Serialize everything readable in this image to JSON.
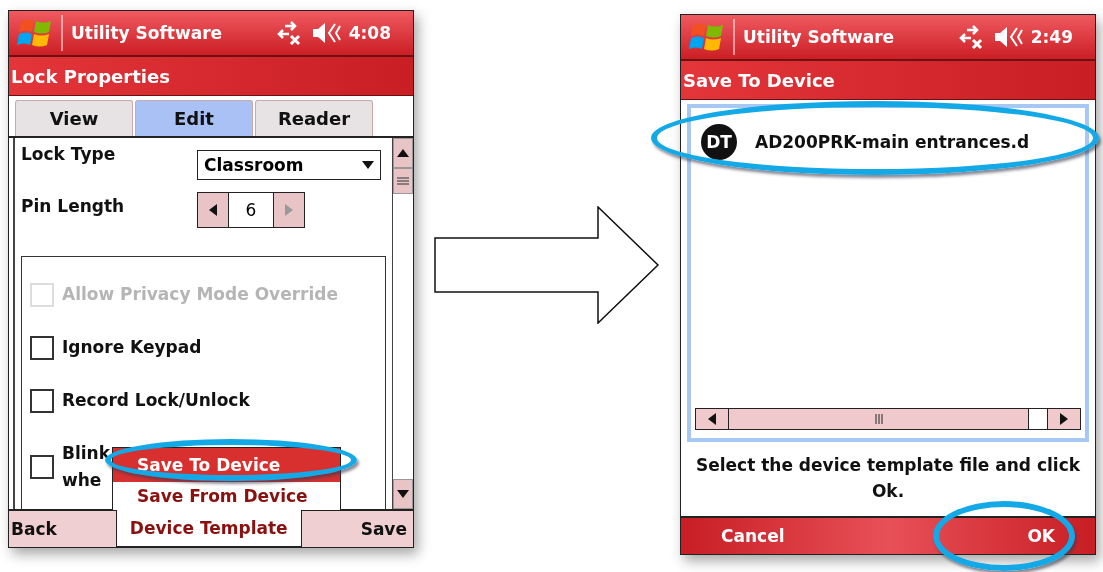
{
  "left_screen": {
    "status_bar": {
      "title": "Utility Software",
      "time": "4:08"
    },
    "title": "Lock Properties",
    "tabs": [
      {
        "label": "View",
        "selected": false
      },
      {
        "label": "Edit",
        "selected": true
      },
      {
        "label": "Reader",
        "selected": false
      }
    ],
    "fields": [
      {
        "kind": "dropdown",
        "label": "Lock Type",
        "value": "Classroom"
      },
      {
        "kind": "spinner",
        "label": "Pin Length",
        "value": "6",
        "at_max": true
      }
    ],
    "options": [
      {
        "label": "Allow Privacy Mode Override",
        "checked": false,
        "disabled": true
      },
      {
        "label": "Ignore Keypad",
        "checked": false,
        "disabled": false
      },
      {
        "label": "Record Lock/Unlock",
        "checked": false,
        "disabled": false
      },
      {
        "label": "Blink\nwhe",
        "checked": false,
        "disabled": false
      }
    ],
    "context_menu": [
      {
        "label": "Save To Device",
        "selected": true
      },
      {
        "label": "Save From Device",
        "selected": false
      }
    ],
    "softkeys": {
      "left": "Back",
      "menu": "Device Template",
      "right": "Save"
    }
  },
  "right_screen": {
    "status_bar": {
      "title": "Utility Software",
      "time": "2:49"
    },
    "title": "Save To Device",
    "files": [
      {
        "icon_text": "DT",
        "name": "AD200PRK-main entrances.d",
        "selected": false
      }
    ],
    "instruction": "Select the device template file and click Ok.",
    "softkeys": {
      "left": "Cancel",
      "right": "OK"
    }
  }
}
